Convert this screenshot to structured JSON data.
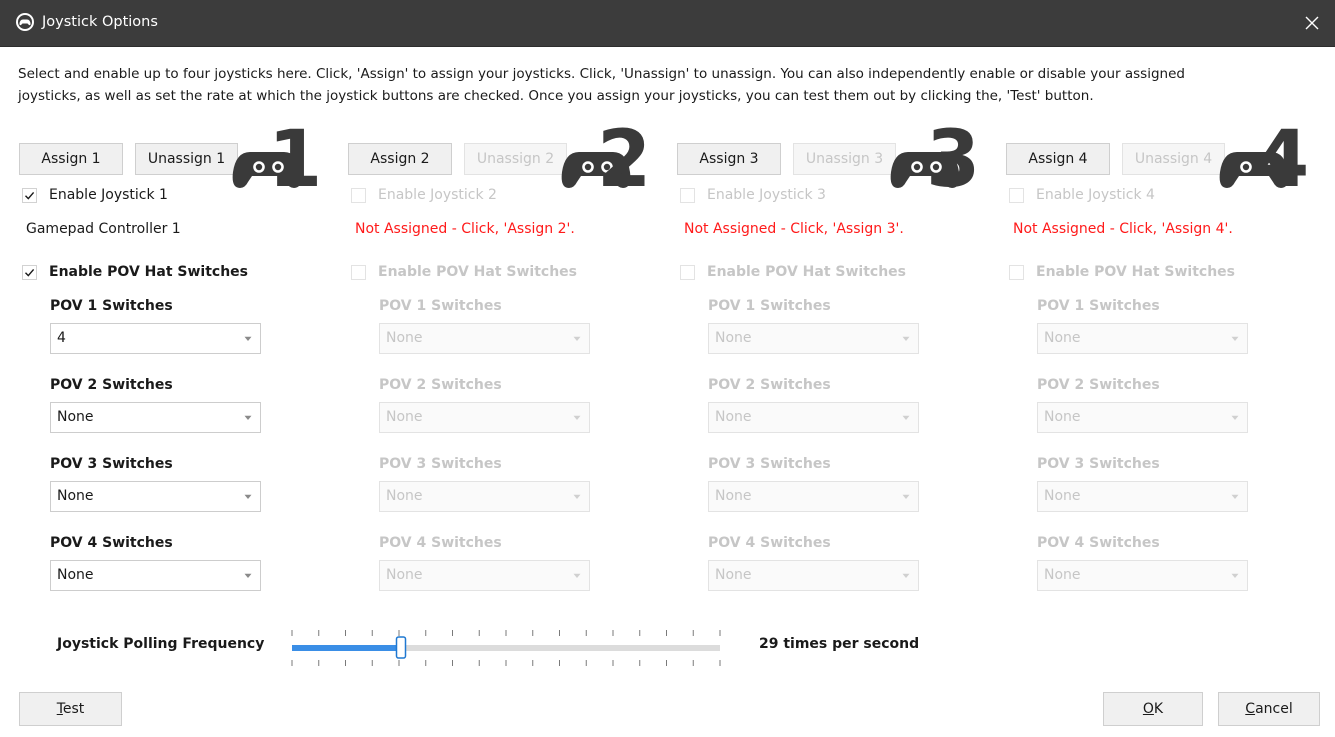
{
  "window": {
    "title": "Joystick Options",
    "app_icon": "gamepad-badge-icon",
    "close_icon": "close-icon"
  },
  "intro": {
    "line1": "Select and enable up to four joysticks here.  Click, 'Assign' to assign your joysticks.  Click, 'Unassign' to unassign.  You can also independently enable or disable your assigned",
    "line2": "joysticks, as well as set the rate at which the joystick buttons are checked.  Once you assign your joysticks, you can test them out by clicking the, 'Test' button."
  },
  "joysticks": [
    {
      "assign_label": "Assign 1",
      "unassign_label": "Unassign 1",
      "unassign_enabled": true,
      "number": "1",
      "enable_label": "Enable Joystick 1",
      "enable_checked": true,
      "enabled": true,
      "status": "Gamepad Controller 1",
      "status_error": false,
      "pov_enable_label": "Enable POV Hat Switches",
      "pov_enable_checked": true,
      "pov": [
        {
          "label": "POV 1 Switches",
          "value": "4"
        },
        {
          "label": "POV 2 Switches",
          "value": "None"
        },
        {
          "label": "POV 3 Switches",
          "value": "None"
        },
        {
          "label": "POV 4 Switches",
          "value": "None"
        }
      ]
    },
    {
      "assign_label": "Assign 2",
      "unassign_label": "Unassign 2",
      "unassign_enabled": false,
      "number": "2",
      "enable_label": "Enable Joystick 2",
      "enable_checked": false,
      "enabled": false,
      "status": "Not Assigned - Click, 'Assign 2'.",
      "status_error": true,
      "pov_enable_label": "Enable POV Hat Switches",
      "pov_enable_checked": false,
      "pov": [
        {
          "label": "POV 1 Switches",
          "value": "None"
        },
        {
          "label": "POV 2 Switches",
          "value": "None"
        },
        {
          "label": "POV 3 Switches",
          "value": "None"
        },
        {
          "label": "POV 4 Switches",
          "value": "None"
        }
      ]
    },
    {
      "assign_label": "Assign 3",
      "unassign_label": "Unassign 3",
      "unassign_enabled": false,
      "number": "3",
      "enable_label": "Enable Joystick 3",
      "enable_checked": false,
      "enabled": false,
      "status": "Not Assigned - Click, 'Assign 3'.",
      "status_error": true,
      "pov_enable_label": "Enable POV Hat Switches",
      "pov_enable_checked": false,
      "pov": [
        {
          "label": "POV 1 Switches",
          "value": "None"
        },
        {
          "label": "POV 2 Switches",
          "value": "None"
        },
        {
          "label": "POV 3 Switches",
          "value": "None"
        },
        {
          "label": "POV 4 Switches",
          "value": "None"
        }
      ]
    },
    {
      "assign_label": "Assign 4",
      "unassign_label": "Unassign 4",
      "unassign_enabled": false,
      "number": "4",
      "enable_label": "Enable Joystick 4",
      "enable_checked": false,
      "enabled": false,
      "status": "Not Assigned - Click, 'Assign 4'.",
      "status_error": true,
      "pov_enable_label": "Enable POV Hat Switches",
      "pov_enable_checked": false,
      "pov": [
        {
          "label": "POV 1 Switches",
          "value": "None"
        },
        {
          "label": "POV 2 Switches",
          "value": "None"
        },
        {
          "label": "POV 3 Switches",
          "value": "None"
        },
        {
          "label": "POV 4 Switches",
          "value": "None"
        }
      ]
    }
  ],
  "polling": {
    "label": "Joystick Polling Frequency",
    "value_text": "29 times per second",
    "tick_count": 17,
    "position_index": 4
  },
  "buttons": {
    "test": {
      "mnemonic": "T",
      "rest": "est"
    },
    "ok": {
      "mnemonic": "O",
      "rest": "K"
    },
    "cancel": {
      "mnemonic": "C",
      "rest": "ancel"
    }
  },
  "colors": {
    "titlebar": "#3c3c3c",
    "error_text": "#ff1a1a",
    "slider_fill": "#3a8ee6",
    "disabled_text": "#c6c6c6"
  }
}
